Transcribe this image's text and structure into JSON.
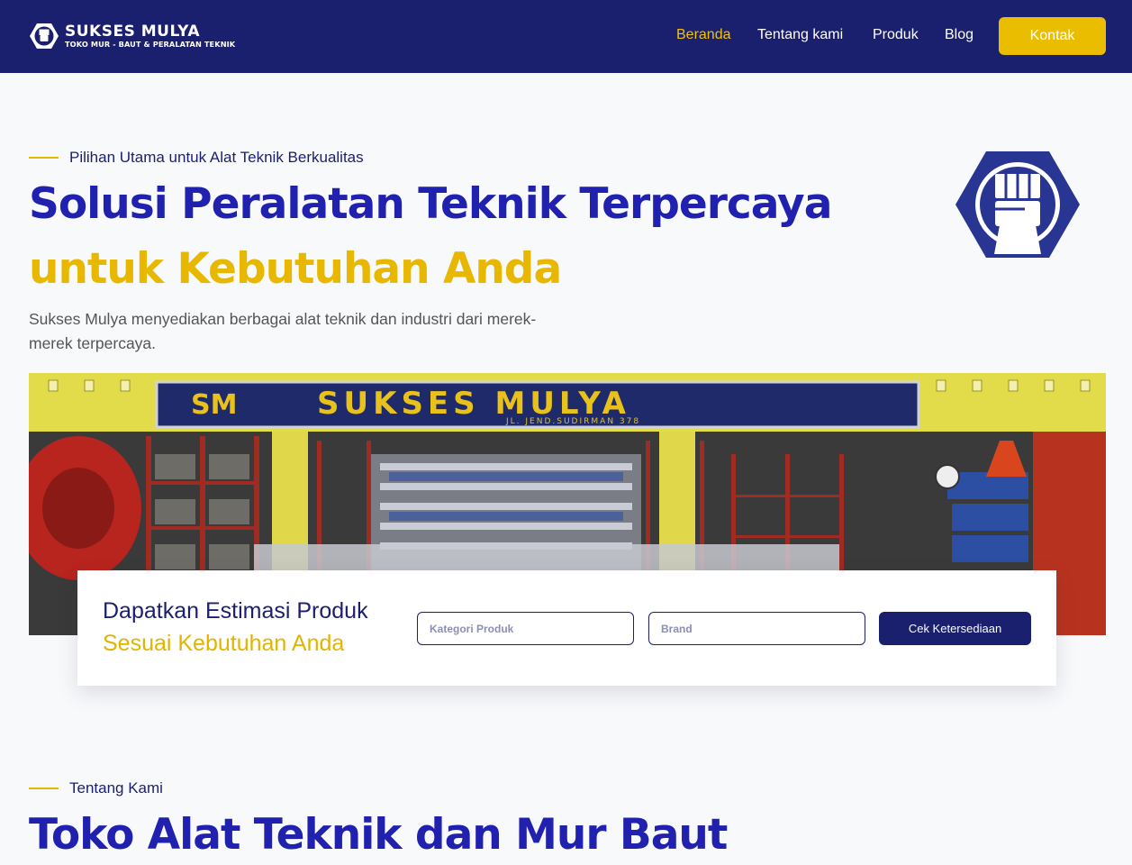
{
  "brand": {
    "name": "SUKSES MULYA",
    "tagline": "TOKO MUR - BAUT & PERALATAN TEKNIK"
  },
  "nav": {
    "items": [
      {
        "label": "Beranda",
        "active": true
      },
      {
        "label": "Tentang kami",
        "active": false
      },
      {
        "label": "Produk",
        "active": false
      },
      {
        "label": "Blog",
        "active": false
      }
    ],
    "cta": "Kontak"
  },
  "hero": {
    "eyebrow": "Pilihan Utama untuk Alat Teknik Berkualitas",
    "title_line1": "Solusi Peralatan Teknik Terpercaya",
    "title_line2": "untuk Kebutuhan Anda",
    "description": "Sukses Mulya menyediakan berbagai alat teknik dan industri dari merek-merek terpercaya."
  },
  "store_image": {
    "sign_text": "SUKSES MULYA",
    "sign_monogram": "SM",
    "sign_address": "JL. JEND.SUDIRMAN 378"
  },
  "estimate": {
    "title_line1": "Dapatkan Estimasi Produk",
    "title_line2": "Sesuai Kebutuhan Anda",
    "category_placeholder": "Kategori Produk",
    "brand_placeholder": "Brand",
    "button": "Cek Ketersediaan"
  },
  "about": {
    "eyebrow": "Tentang Kami",
    "title": "Toko Alat Teknik dan Mur Baut"
  },
  "colors": {
    "navy": "#1a1f6e",
    "royal_blue": "#2121b0",
    "gold": "#e8b800",
    "background": "#f8f9fb"
  }
}
